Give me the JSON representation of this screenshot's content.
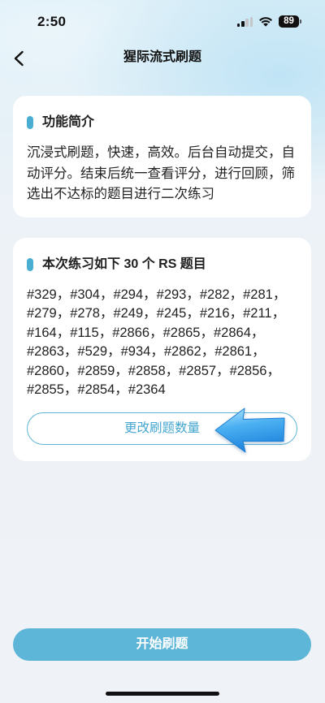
{
  "status_bar": {
    "time": "2:50",
    "battery_level": "89",
    "icons": [
      "cellular-signal-icon",
      "wifi-icon",
      "battery-icon"
    ]
  },
  "nav": {
    "title": "猩际流式刷题",
    "back_icon": "chevron-left-icon"
  },
  "intro_card": {
    "title": "功能简介",
    "body": "沉浸式刷题，快速，高效。后台自动提交，自动评分。结束后统一查看评分，进行回顾，筛选出不达标的题目进行二次练习"
  },
  "practice_card": {
    "title": "本次练习如下 30 个 RS 题目",
    "separator": "，",
    "problems": [
      "#329",
      "#304",
      "#294",
      "#293",
      "#282",
      "#281",
      "#279",
      "#278",
      "#249",
      "#245",
      "#216",
      "#211",
      "#164",
      "#115",
      "#2866",
      "#2865",
      "#2864",
      "#2863",
      "#529",
      "#934",
      "#2862",
      "#2861",
      "#2860",
      "#2859",
      "#2858",
      "#2857",
      "#2856",
      "#2855",
      "#2854",
      "#2364"
    ],
    "change_button_label": "更改刷题数量"
  },
  "annotation_icon": "arrow-left-icon",
  "start_button_label": "开始刷题",
  "colors": {
    "accent": "#4aaed3",
    "primary_button": "#5db6d7",
    "outline_button": "#5fb4d6",
    "outline_button_text": "#45a6cf",
    "arrow": "#3aa0ea",
    "text": "#222222"
  }
}
